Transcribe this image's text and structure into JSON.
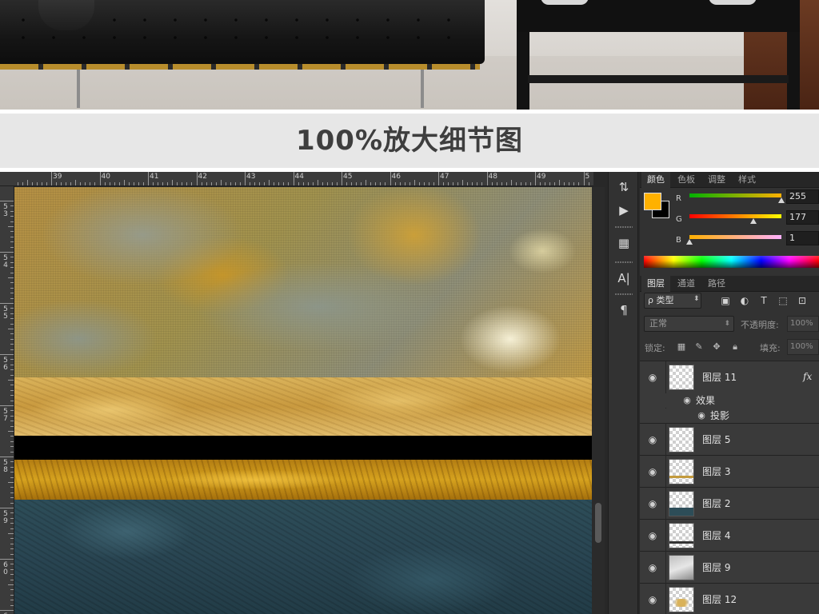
{
  "caption": {
    "title": "100%放大细节图"
  },
  "ruler": {
    "top_numbers": [
      "39",
      "40",
      "41",
      "42",
      "43",
      "44",
      "45",
      "46",
      "47",
      "48",
      "49",
      "5"
    ],
    "left_numbers": [
      "53",
      "54",
      "55",
      "56",
      "57",
      "58",
      "59",
      "60",
      "61"
    ]
  },
  "tools": [
    {
      "icon": "history-icon",
      "glyph": "⇅"
    },
    {
      "icon": "play-icon",
      "glyph": "▶"
    },
    {
      "icon": "3d-icon",
      "glyph": "▦"
    },
    {
      "icon": "character-icon",
      "glyph": "A|"
    },
    {
      "icon": "paragraph-icon",
      "glyph": "¶"
    }
  ],
  "color_panel": {
    "tabs": [
      "颜色",
      "色板",
      "调整",
      "样式"
    ],
    "foreground": "#ffb100",
    "background": "#000000",
    "channels": [
      {
        "label": "R",
        "value": "255",
        "fraction": 1.0,
        "gradient": "linear-gradient(90deg,#00b100,#ffb100)"
      },
      {
        "label": "G",
        "value": "177",
        "fraction": 0.694,
        "gradient": "linear-gradient(90deg,#ff0000,#ffff00)"
      },
      {
        "label": "B",
        "value": "1",
        "fraction": 0.004,
        "gradient": "linear-gradient(90deg,#ffb000,#ffb1ff)"
      }
    ]
  },
  "layers_panel": {
    "tabs": [
      "图层",
      "通道",
      "路径"
    ],
    "kind_label": "ρ 类型",
    "blend_mode": "正常",
    "opacity_label": "不透明度:",
    "opacity_value": "100%",
    "lock_label": "锁定:",
    "fill_label": "填充:",
    "fill_value": "100%",
    "filter_icons": [
      "image-filter-icon",
      "adjustment-filter-icon",
      "type-filter-icon",
      "shape-filter-icon",
      "smart-object-filter-icon"
    ],
    "layers": [
      {
        "name": "图层 11",
        "fx": "fx",
        "thumb": "blank"
      },
      {
        "name": "图层 5",
        "fx": "",
        "thumb": "blank"
      },
      {
        "name": "图层 3",
        "fx": "",
        "thumb": "gold-line"
      },
      {
        "name": "图层 2",
        "fx": "",
        "thumb": "teal-bottom"
      },
      {
        "name": "图层 4",
        "fx": "",
        "thumb": "dark-line"
      },
      {
        "name": "图层 9",
        "fx": "",
        "thumb": "marble"
      },
      {
        "name": "图层 12",
        "fx": "",
        "thumb": "gold-speck"
      }
    ],
    "effects": {
      "group_label": "效果",
      "item_label": "投影"
    }
  }
}
